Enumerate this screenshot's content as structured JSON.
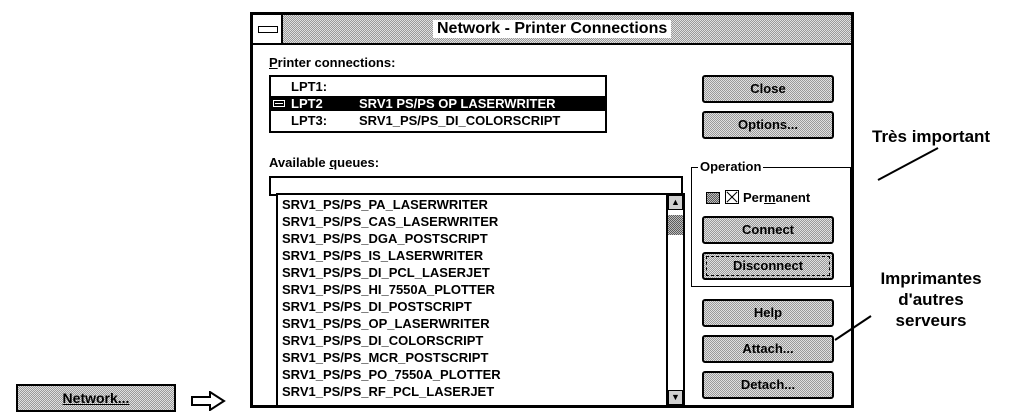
{
  "window": {
    "title": "Network - Printer Connections"
  },
  "printer_connections": {
    "label_accel": "P",
    "label_rest": "rinter connections:",
    "rows": [
      {
        "port": "LPT1:",
        "queue": ""
      },
      {
        "port": "LPT2",
        "queue": "SRV1 PS/PS OP LASERWRITER",
        "selected": true
      },
      {
        "port": "LPT3:",
        "queue": "SRV1_PS/PS_DI_COLORSCRIPT"
      }
    ]
  },
  "queues": {
    "label_pre": "Available ",
    "label_accel": "q",
    "label_post": "ueues:",
    "input_value": "",
    "items": [
      "SRV1_PS/PS_PA_LASERWRITER",
      "SRV1_PS/PS_CAS_LASERWRITER",
      "SRV1_PS/PS_DGA_POSTSCRIPT",
      "SRV1_PS/PS_IS_LASERWRITER",
      "SRV1_PS/PS_DI_PCL_LASERJET",
      "SRV1_PS/PS_HI_7550A_PLOTTER",
      "SRV1_PS/PS_DI_POSTSCRIPT",
      "SRV1_PS/PS_OP_LASERWRITER",
      "SRV1_PS/PS_DI_COLORSCRIPT",
      "SRV1_PS/PS_MCR_POSTSCRIPT",
      "SRV1_PS/PS_PO_7550A_PLOTTER",
      "SRV1_PS/PS_RF_PCL_LASERJET"
    ]
  },
  "buttons": {
    "close": "Close",
    "options": "Options...",
    "connect": "Connect",
    "disconnect": "Disconnect",
    "help": "Help",
    "attach": "Attach...",
    "detach": "Detach..."
  },
  "operation": {
    "title": "Operation",
    "permanent_pre": "Per",
    "permanent_accel": "m",
    "permanent_post": "anent",
    "permanent_checked": true
  },
  "annotations": {
    "important": "Très important",
    "other_servers_line1": "Imprimantes",
    "other_servers_line2": "d'autres",
    "other_servers_line3": "serveurs"
  },
  "network_button": {
    "label": "Network..."
  },
  "icons": {
    "system_menu": "system-menu-icon",
    "arrow": "right-arrow-icon",
    "checkbox": "checkbox-icon"
  }
}
